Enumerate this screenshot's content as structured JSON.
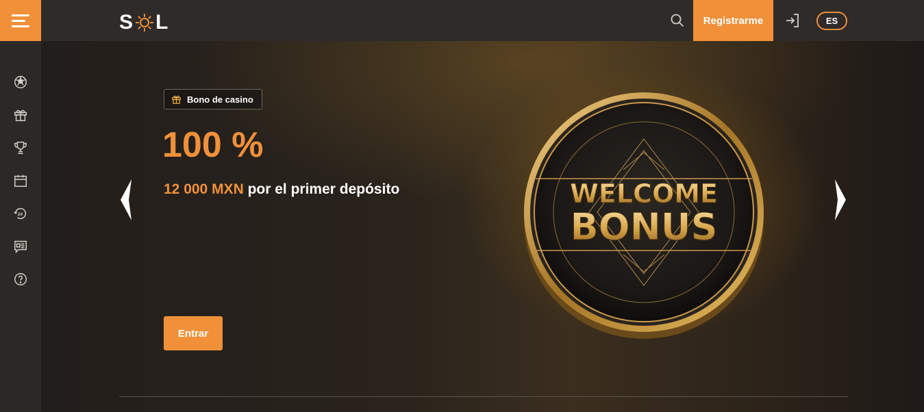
{
  "sidebar": {
    "menu_icon": "hamburger-menu-icon",
    "items": [
      {
        "icon": "soccer-ball-icon"
      },
      {
        "icon": "gift-icon"
      },
      {
        "icon": "trophy-icon"
      },
      {
        "icon": "calendar-icon"
      },
      {
        "icon": "support-24-icon"
      },
      {
        "icon": "news-icon"
      },
      {
        "icon": "help-icon"
      }
    ]
  },
  "header": {
    "logo_left": "S",
    "logo_right": "L",
    "register_label": "Registrarme",
    "language": "ES",
    "search_icon": "search-icon",
    "login_icon": "login-icon"
  },
  "banner": {
    "badge_label": "Bono de casino",
    "headline": "100 %",
    "amount": "12 000 MXN",
    "subtitle": " por el primer depósito",
    "enter_label": "Entrar",
    "coin_line1": "WELCOME",
    "coin_line2": "BONUS"
  },
  "colors": {
    "accent": "#f0913a",
    "sidebar_bg": "#2c2825",
    "header_bg": "#2f2b28"
  }
}
